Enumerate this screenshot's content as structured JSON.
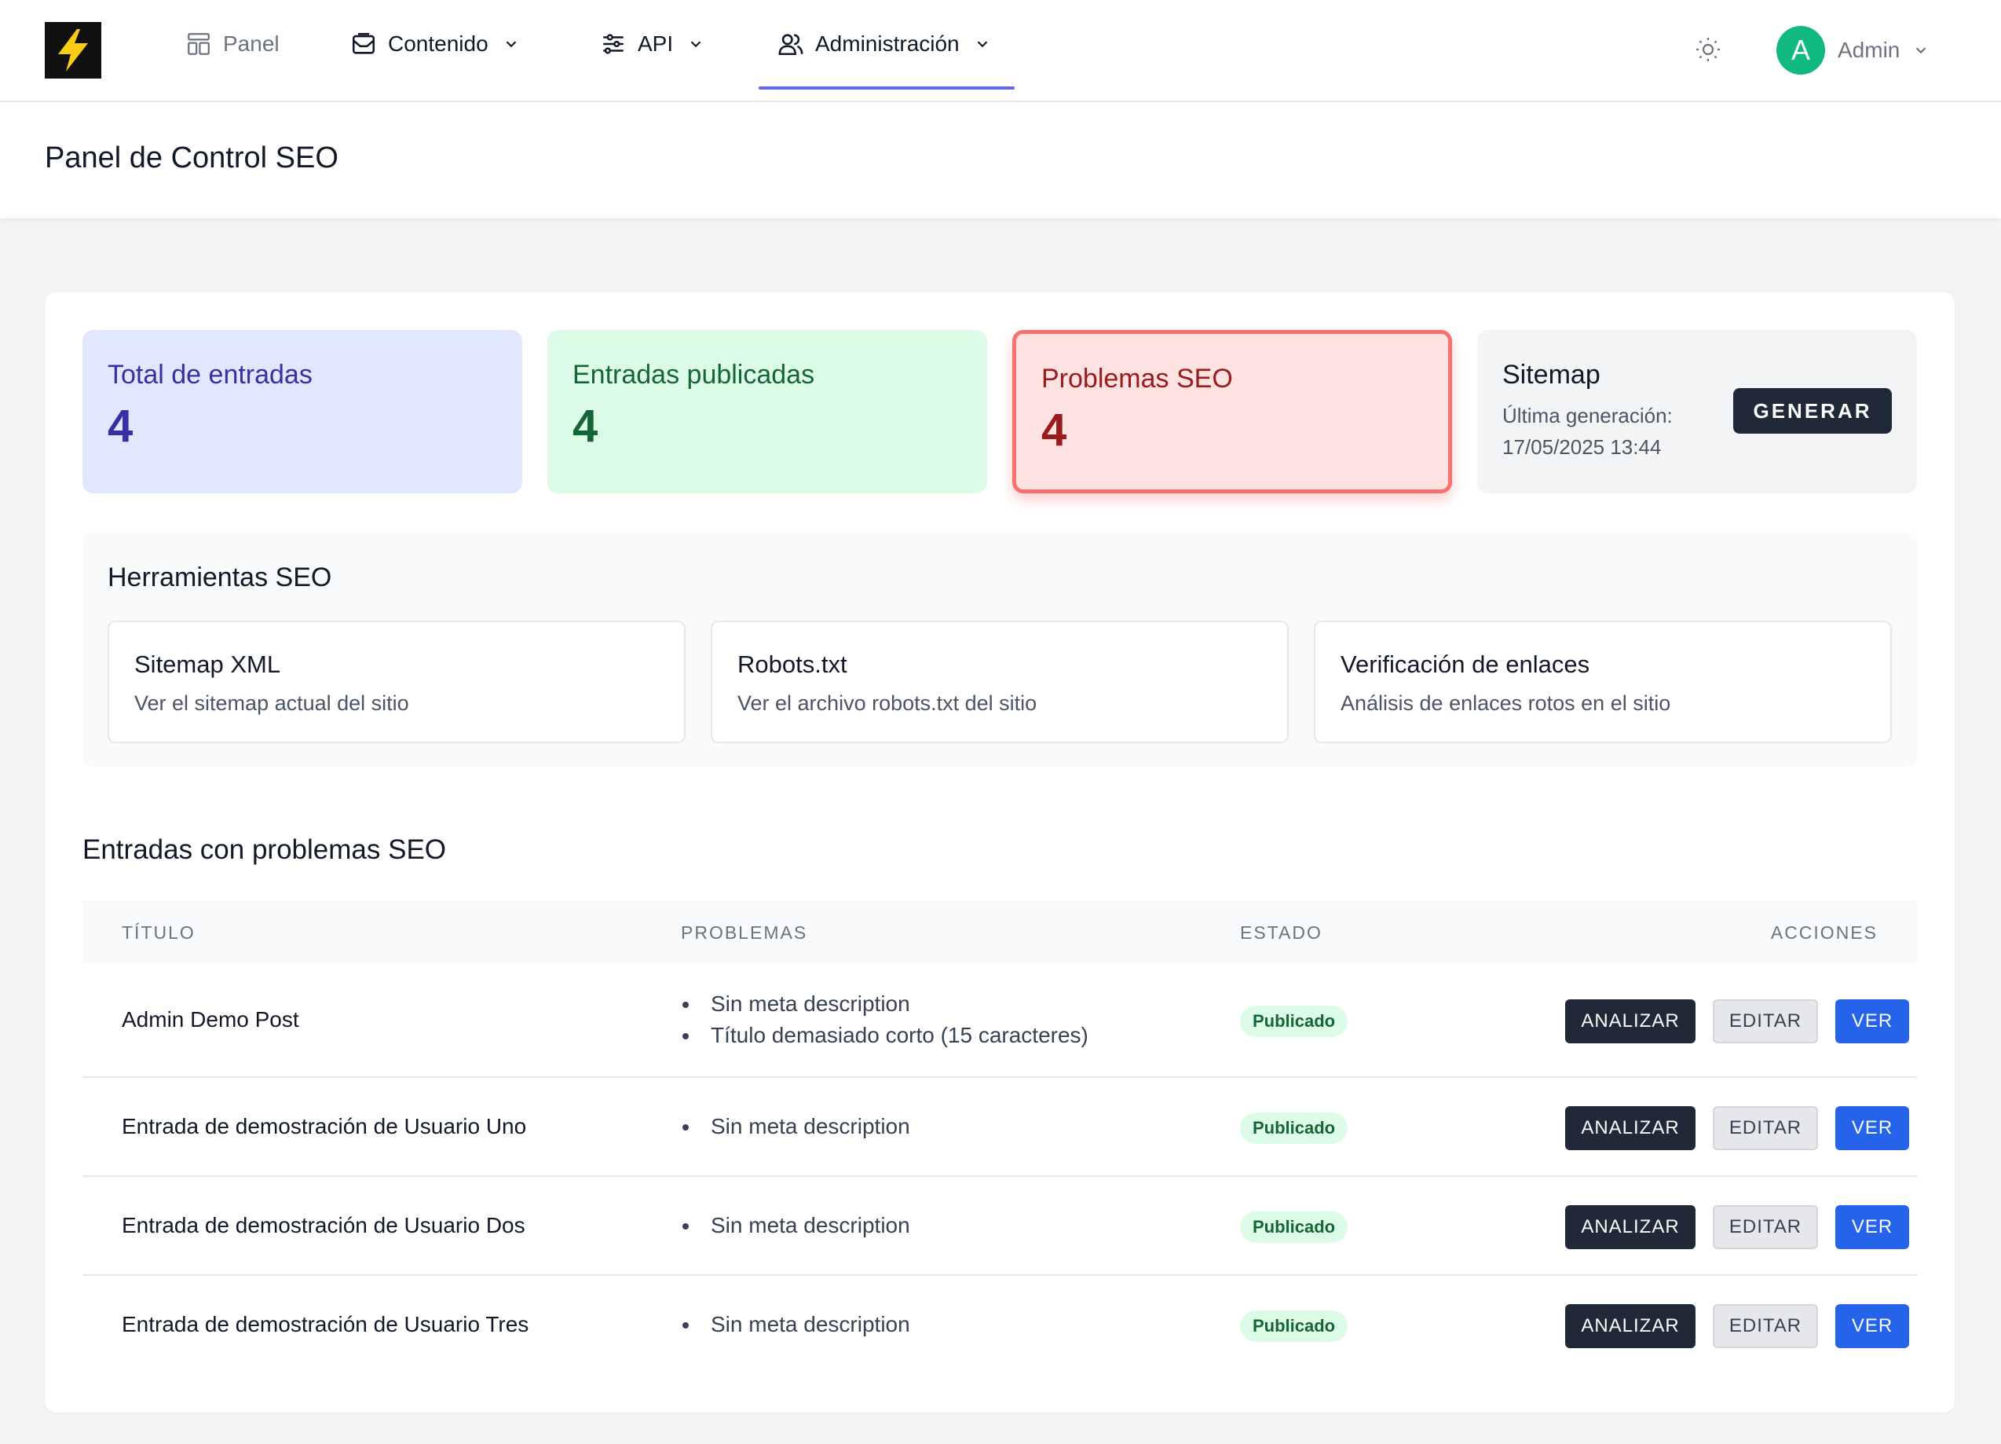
{
  "nav": {
    "items": [
      {
        "label": "Panel",
        "icon": "layout-icon"
      },
      {
        "label": "Contenido",
        "icon": "inbox-icon"
      },
      {
        "label": "API",
        "icon": "sliders-icon"
      },
      {
        "label": "Administración",
        "icon": "users-icon"
      }
    ],
    "active": "Administración",
    "active_color": "#6366f1",
    "theme_icon": "sun-icon",
    "user": {
      "initial": "A",
      "name": "Admin",
      "avatar_color": "#10b981"
    }
  },
  "header": {
    "title": "Panel de Control SEO"
  },
  "stats": {
    "total": {
      "label": "Total de entradas",
      "value": "4",
      "color": "#3730a3"
    },
    "published": {
      "label": "Entradas publicadas",
      "value": "4",
      "color": "#166534"
    },
    "problems": {
      "label": "Problemas SEO",
      "value": "4",
      "color": "#991b1b"
    },
    "sitemap": {
      "title": "Sitemap",
      "last_label": "Última generación:",
      "last_date": "17/05/2025 13:44",
      "button": "GENERAR"
    }
  },
  "tools": {
    "title": "Herramientas SEO",
    "items": [
      {
        "title": "Sitemap XML",
        "desc": "Ver el sitemap actual del sitio"
      },
      {
        "title": "Robots.txt",
        "desc": "Ver el archivo robots.txt del sitio"
      },
      {
        "title": "Verificación de enlaces",
        "desc": "Análisis de enlaces rotos en el sitio"
      }
    ]
  },
  "table": {
    "title": "Entradas con problemas SEO",
    "headers": {
      "title": "TÍTULO",
      "problems": "PROBLEMAS",
      "status": "ESTADO",
      "actions": "ACCIONES"
    },
    "action_labels": {
      "analyze": "ANALIZAR",
      "edit": "EDITAR",
      "view": "VER"
    },
    "rows": [
      {
        "title": "Admin Demo Post",
        "problems": [
          "Sin meta description",
          "Título demasiado corto (15 caracteres)"
        ],
        "status": "Publicado"
      },
      {
        "title": "Entrada de demostración de Usuario Uno",
        "problems": [
          "Sin meta description"
        ],
        "status": "Publicado"
      },
      {
        "title": "Entrada de demostración de Usuario Dos",
        "problems": [
          "Sin meta description"
        ],
        "status": "Publicado"
      },
      {
        "title": "Entrada de demostración de Usuario Tres",
        "problems": [
          "Sin meta description"
        ],
        "status": "Publicado"
      }
    ]
  }
}
